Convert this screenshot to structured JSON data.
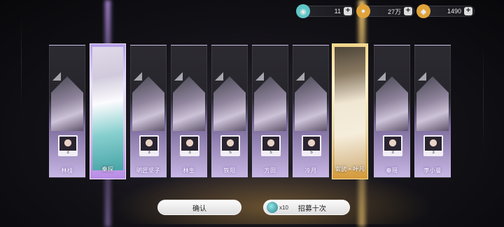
{
  "resources": [
    {
      "icon": "recruit-ticket-icon",
      "value": "11",
      "plus": "+",
      "color": "#5fc6c8"
    },
    {
      "icon": "coin-icon",
      "value": "27万",
      "plus": "+",
      "color": "#e0a33a"
    },
    {
      "icon": "gem-icon",
      "value": "1490",
      "plus": "+",
      "color": "#e0a33a"
    }
  ],
  "cards": [
    {
      "name": "林桂",
      "count": "3",
      "highlight": "none"
    },
    {
      "name": "秦探",
      "count": "",
      "highlight": "purple"
    },
    {
      "name": "明匠坚子",
      "count": "3",
      "highlight": "none"
    },
    {
      "name": "林生",
      "count": "3",
      "highlight": "none"
    },
    {
      "name": "铁阳",
      "count": "5",
      "highlight": "none"
    },
    {
      "name": "方田",
      "count": "5",
      "highlight": "none"
    },
    {
      "name": "冷月",
      "count": "5",
      "highlight": "none"
    },
    {
      "name": "玄武・叶凡",
      "count": "",
      "highlight": "gold"
    },
    {
      "name": "秦瑶",
      "count": "3",
      "highlight": "none"
    },
    {
      "name": "李小曼",
      "count": "3",
      "highlight": "none"
    }
  ],
  "buttons": {
    "confirm": "确认",
    "recruit_cost": "x10",
    "recruit": "招募十次"
  }
}
